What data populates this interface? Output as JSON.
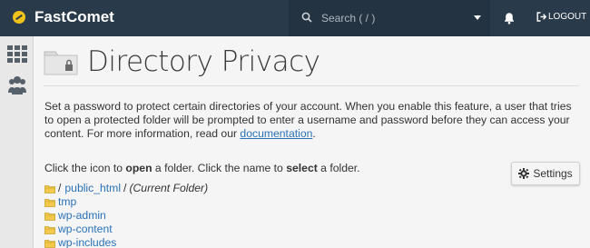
{
  "header": {
    "brand": "FastComet",
    "search_placeholder": "Search ( / )",
    "logout_label": "LOGOUT"
  },
  "page": {
    "title": "Directory Privacy",
    "description_text": "Set a password to protect certain directories of your account. When you enable this feature, a user that tries to open a protected folder will be prompted to enter a username and password before they can access your content. For more information, read our ",
    "documentation_link": "documentation",
    "description_end": ".",
    "instruct_1": "Click the icon to ",
    "instruct_open": "open",
    "instruct_2": " a folder. Click the name to ",
    "instruct_select": "select",
    "instruct_3": " a folder.",
    "settings_label": "Settings"
  },
  "folders": {
    "root_prefix": "/",
    "root_name": "public_html",
    "root_suffix": "/",
    "current_label": "(Current Folder)",
    "items": [
      "tmp",
      "wp-admin",
      "wp-content",
      "wp-includes"
    ]
  },
  "colors": {
    "topbar": "#293a4a",
    "link": "#2a72b8",
    "folder_icon": "#f2c94c"
  }
}
